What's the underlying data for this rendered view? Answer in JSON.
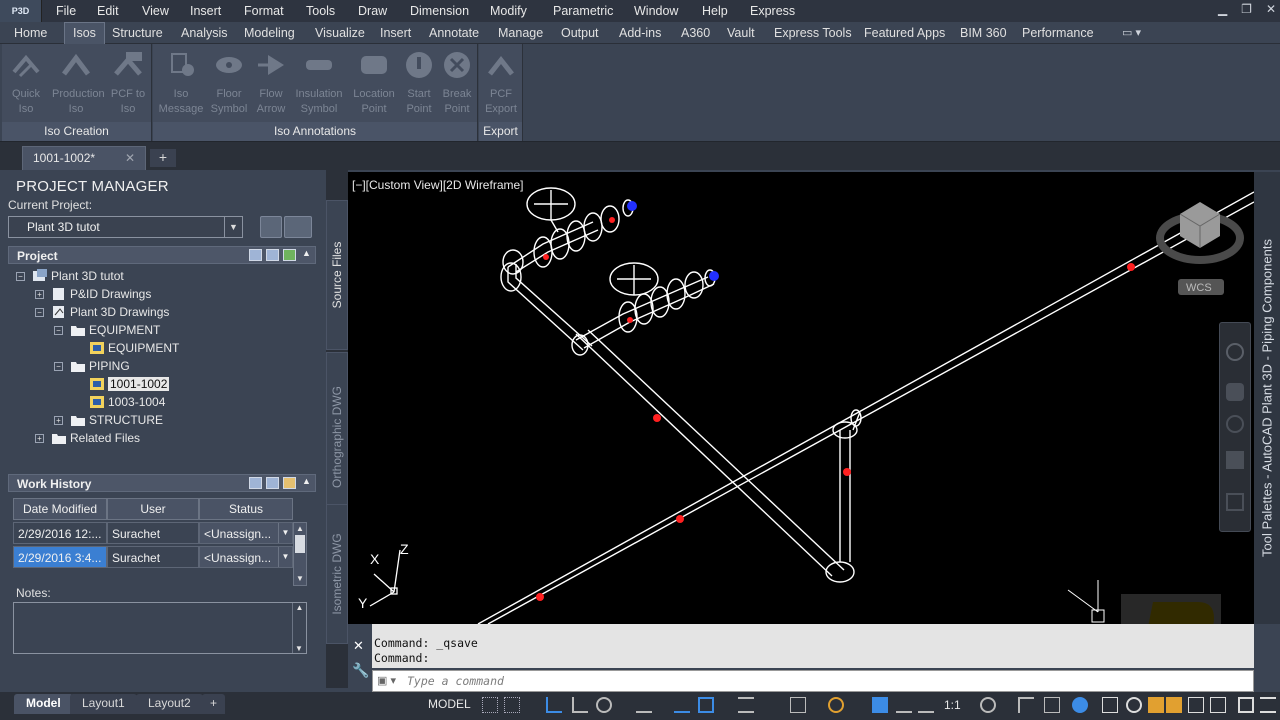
{
  "app": {
    "logo_text": "P3D"
  },
  "menu": [
    "File",
    "Edit",
    "View",
    "Insert",
    "Format",
    "Tools",
    "Draw",
    "Dimension",
    "Modify",
    "Parametric",
    "Window",
    "Help",
    "Express"
  ],
  "ribbon_tabs": [
    "Home",
    "Isos",
    "Structure",
    "Analysis",
    "Modeling",
    "Visualize",
    "Insert",
    "Annotate",
    "Manage",
    "Output",
    "Add-ins",
    "A360",
    "Vault",
    "Express Tools",
    "Featured Apps",
    "BIM 360",
    "Performance"
  ],
  "ribbon_active_tab": "Isos",
  "ribbon_panels": [
    {
      "title": "Iso Creation",
      "buttons": [
        {
          "label1": "Quick",
          "label2": "Iso",
          "icon": "quick-iso-icon"
        },
        {
          "label1": "Production",
          "label2": "Iso",
          "icon": "production-iso-icon"
        },
        {
          "label1": "PCF to",
          "label2": "Iso",
          "icon": "pcf-to-iso-icon"
        }
      ]
    },
    {
      "title": "Iso Annotations",
      "buttons": [
        {
          "label1": "Iso",
          "label2": "Message",
          "icon": "iso-message-icon"
        },
        {
          "label1": "Floor",
          "label2": "Symbol",
          "icon": "floor-symbol-icon"
        },
        {
          "label1": "Flow",
          "label2": "Arrow",
          "icon": "flow-arrow-icon"
        },
        {
          "label1": "Insulation",
          "label2": "Symbol",
          "icon": "insulation-symbol-icon"
        },
        {
          "label1": "Location",
          "label2": "Point",
          "icon": "location-point-icon"
        },
        {
          "label1": "Start",
          "label2": "Point",
          "icon": "start-point-icon"
        },
        {
          "label1": "Break",
          "label2": "Point",
          "icon": "break-point-icon"
        }
      ]
    },
    {
      "title": "Export",
      "buttons": [
        {
          "label1": "PCF",
          "label2": "Export",
          "icon": "pcf-export-icon"
        }
      ]
    }
  ],
  "doc_tab": {
    "label": "1001-1002*",
    "close": "✕",
    "new": "+"
  },
  "project_manager": {
    "title": "PROJECT MANAGER",
    "current_project_label": "Current Project:",
    "current_project": "Plant 3D tutot",
    "project_header": "Project",
    "tree": [
      {
        "label": "Plant 3D tutot",
        "exp": "−",
        "level": 0
      },
      {
        "label": "P&ID Drawings",
        "exp": "+",
        "level": 1
      },
      {
        "label": "Plant 3D Drawings",
        "exp": "−",
        "level": 1
      },
      {
        "label": "EQUIPMENT",
        "exp": "−",
        "level": 2
      },
      {
        "label": "EQUIPMENT",
        "exp": "",
        "level": 3
      },
      {
        "label": "PIPING",
        "exp": "−",
        "level": 2
      },
      {
        "label": "1001-1002",
        "exp": "",
        "level": 3,
        "selected": true
      },
      {
        "label": "1003-1004",
        "exp": "",
        "level": 3
      },
      {
        "label": "STRUCTURE",
        "exp": "+",
        "level": 2
      },
      {
        "label": "Related Files",
        "exp": "+",
        "level": 1
      }
    ],
    "work_history_header": "Work History",
    "wh_columns": [
      "Date Modified",
      "User",
      "Status"
    ],
    "wh_rows": [
      {
        "date": "2/29/2016 12:...",
        "user": "Surachet",
        "status": "<Unassign..."
      },
      {
        "date": "2/29/2016 3:4...",
        "user": "Surachet",
        "status": "<Unassign..."
      }
    ],
    "notes_label": "Notes:"
  },
  "vertical_tabs": [
    "Source Files",
    "Orthographic DWG",
    "Isometric DWG"
  ],
  "viewport": {
    "label": "[−][Custom View][2D Wireframe]",
    "wcs": "WCS",
    "axis_x": "X",
    "axis_y": "Y",
    "axis_z": "Z"
  },
  "palette_title": "Tool Palettes - AutoCAD Plant 3D - Piping Components",
  "command": {
    "line1": "Command:  _qsave",
    "line2": "Command:",
    "placeholder": "Type a command"
  },
  "layout_tabs": [
    "Model",
    "Layout1",
    "Layout2"
  ],
  "status": {
    "model": "MODEL",
    "scale": "1:1"
  }
}
